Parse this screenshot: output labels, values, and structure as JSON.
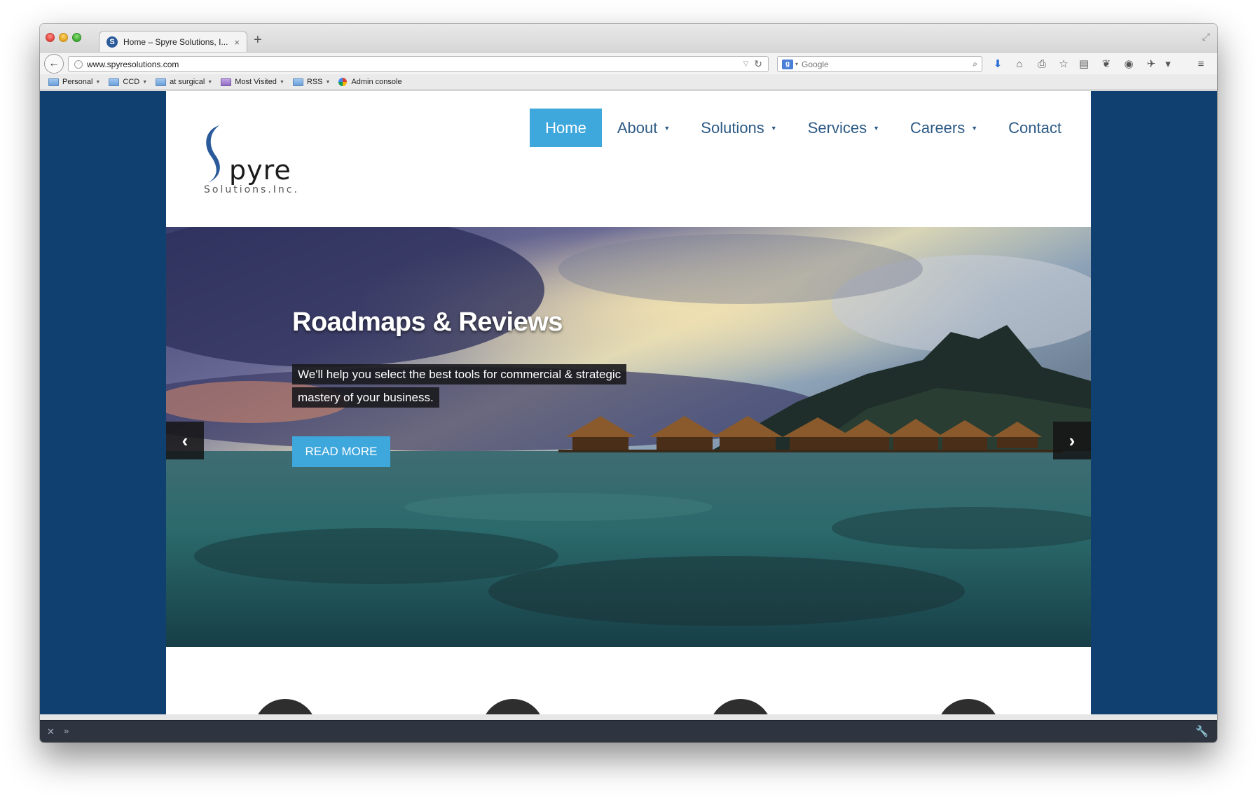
{
  "browser": {
    "tab_title": "Home – Spyre Solutions, I...",
    "tab_close": "×",
    "new_tab": "+",
    "url": "www.spyresolutions.com",
    "search_placeholder": "Google",
    "bookmarks": [
      {
        "label": "Personal",
        "type": "folder"
      },
      {
        "label": "CCD",
        "type": "folder"
      },
      {
        "label": "at surgical",
        "type": "folder"
      },
      {
        "label": "Most Visited",
        "type": "special"
      },
      {
        "label": "RSS",
        "type": "folder"
      },
      {
        "label": "Admin console",
        "type": "link"
      }
    ]
  },
  "site": {
    "logo_initial": "S",
    "logo_word": "pyre",
    "logo_sub": "Solutions.Inc.",
    "nav": [
      {
        "label": "Home",
        "active": true,
        "dropdown": false
      },
      {
        "label": "About",
        "active": false,
        "dropdown": true
      },
      {
        "label": "Solutions",
        "active": false,
        "dropdown": true
      },
      {
        "label": "Services",
        "active": false,
        "dropdown": true
      },
      {
        "label": "Careers",
        "active": false,
        "dropdown": true
      },
      {
        "label": "Contact",
        "active": false,
        "dropdown": false
      }
    ],
    "slide": {
      "title": "Roadmaps & Reviews",
      "text": "We'll help you select the best tools for commercial & strategic mastery of your business.",
      "button": "READ MORE",
      "prev": "‹",
      "next": "›"
    }
  },
  "colors": {
    "accent": "#3ea7dc",
    "page_bg": "#10406f",
    "nav_text": "#2c5a84"
  }
}
